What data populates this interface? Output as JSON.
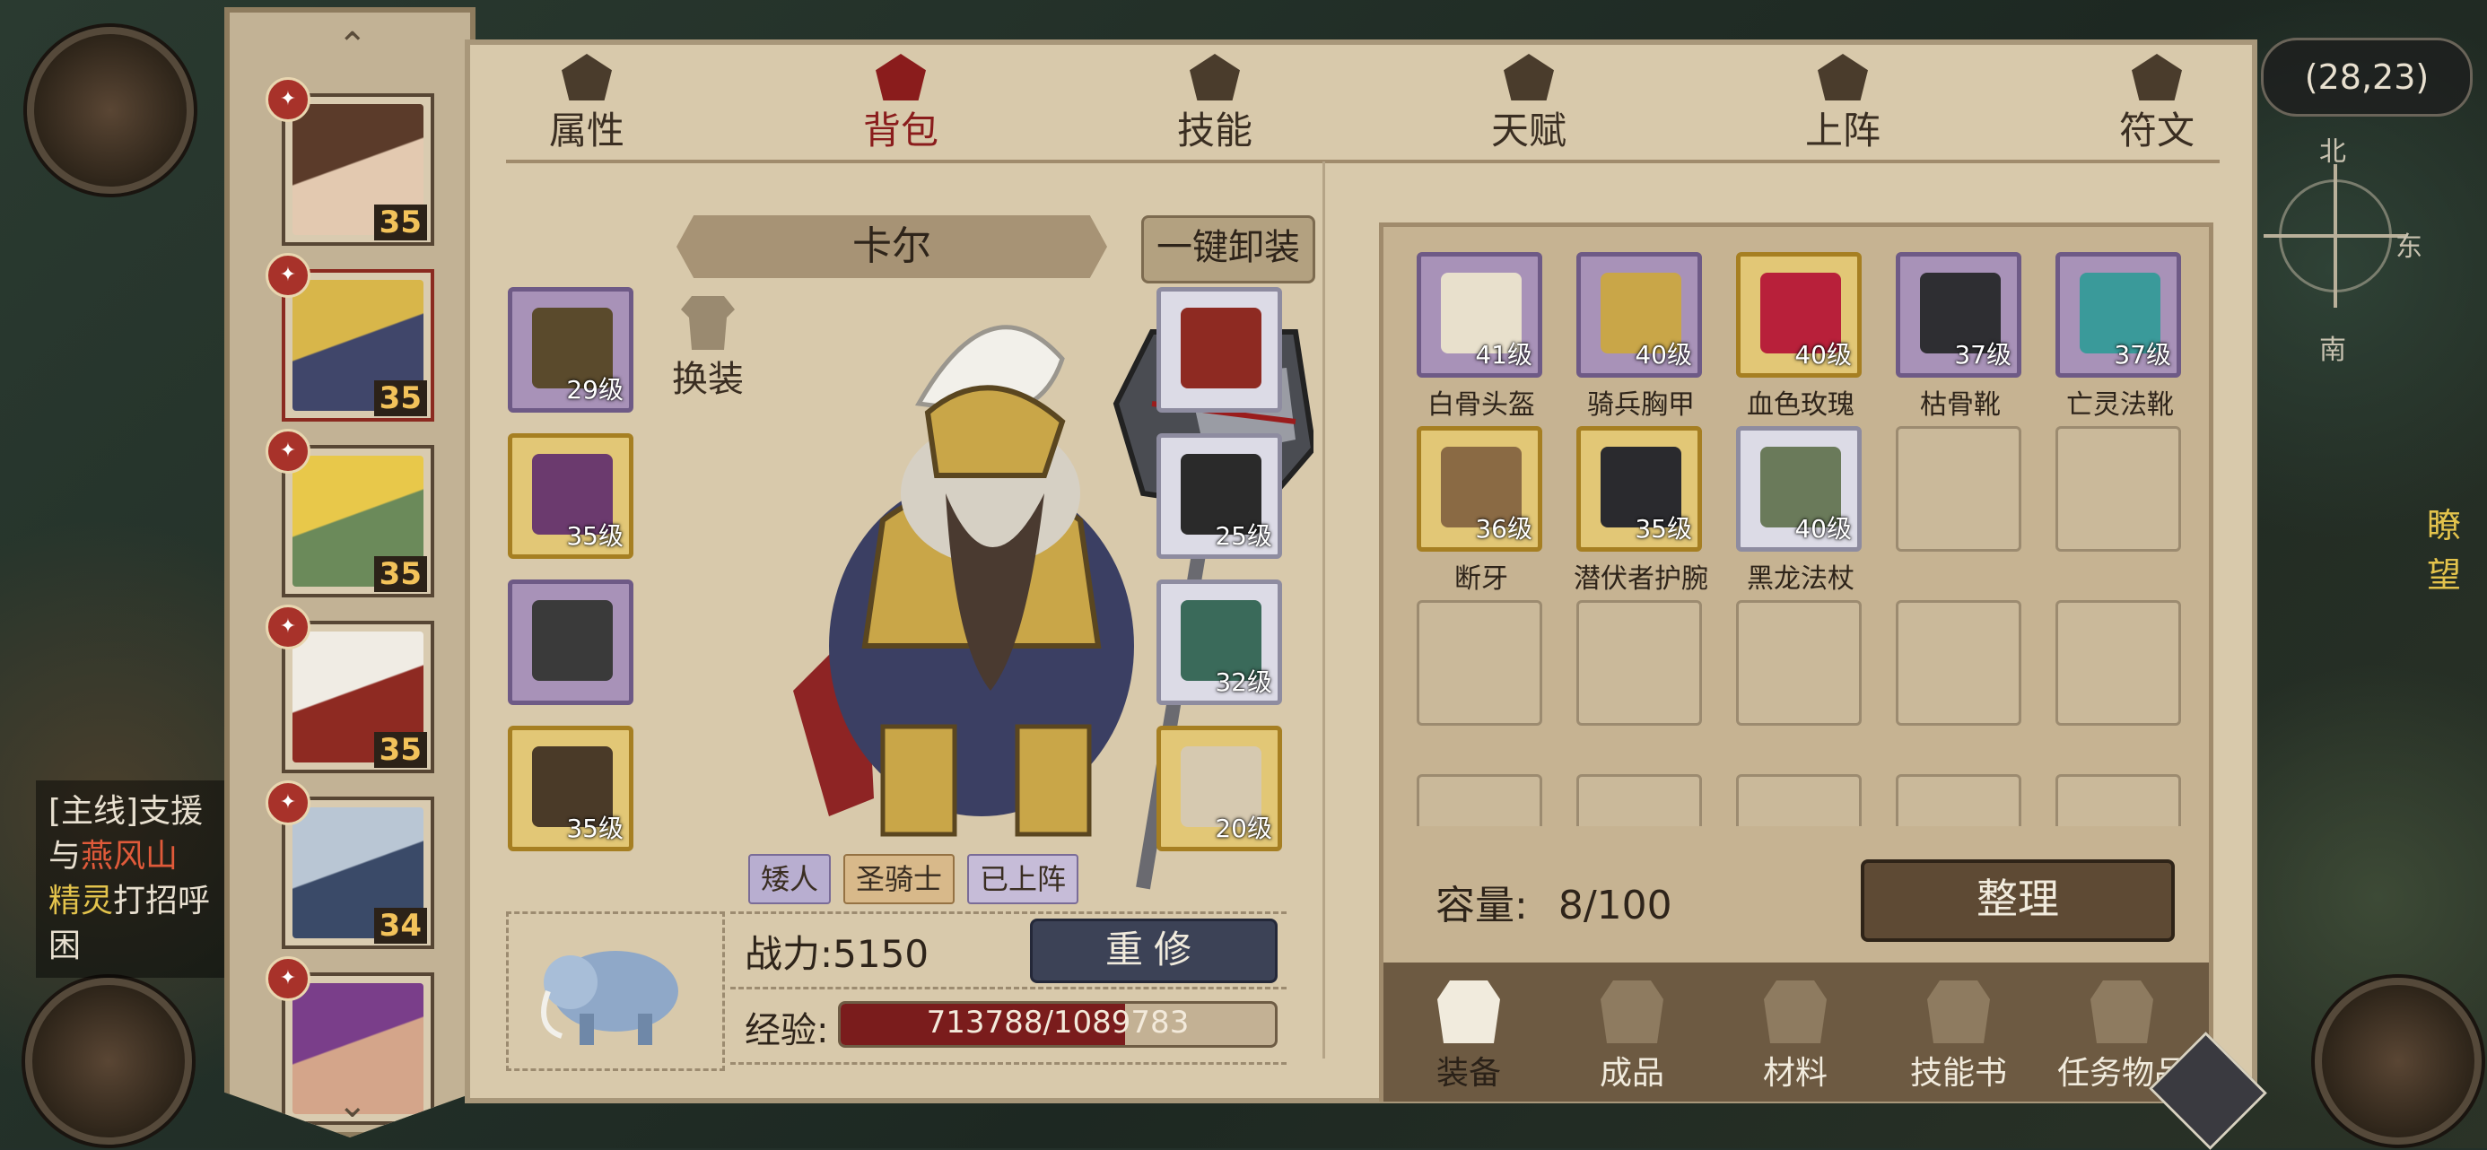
{
  "map": {
    "coord": "(28,23)",
    "compass": {
      "north": "北",
      "east": "东",
      "south": "南"
    },
    "side_text": "瞭望"
  },
  "quest": {
    "tag": "[主线]支援",
    "line1_a": "与",
    "line1_b": "燕风山",
    "line2_a": "精灵",
    "line2_b": "打招呼",
    "line3": "困"
  },
  "heroes": [
    {
      "level": "35",
      "colors": [
        "#5b3b2a",
        "#e3c9b0"
      ]
    },
    {
      "level": "35",
      "colors": [
        "#d8b64a",
        "#40466a"
      ],
      "selected": true
    },
    {
      "level": "35",
      "colors": [
        "#e8c84a",
        "#6b8a5a"
      ]
    },
    {
      "level": "35",
      "colors": [
        "#f0ece4",
        "#8e2a22"
      ]
    },
    {
      "level": "34",
      "colors": [
        "#b9c6d4",
        "#3a4a68"
      ]
    },
    {
      "level": "",
      "colors": [
        "#7a3e8a",
        "#d4a58a"
      ]
    }
  ],
  "tabs": [
    "属性",
    "背包",
    "技能",
    "天赋",
    "上阵",
    "符文"
  ],
  "active_tab": 1,
  "character": {
    "name": "卡尔",
    "unequip_all": "一键卸装",
    "swap": "换装",
    "tags": [
      "矮人",
      "圣骑士",
      "已上阵"
    ],
    "power": "战力:5150",
    "rebuild": "重修",
    "exp_label": "经验:",
    "exp_text": "713788/1089783",
    "exp_ratio": 0.655
  },
  "equip_left": [
    {
      "level": "29级",
      "quality": "purple",
      "art": "#5a4a2c"
    },
    {
      "level": "35级",
      "quality": "gold",
      "art": "#6b3a6e"
    },
    {
      "level": "",
      "quality": "purple",
      "art": "#3a3a3a"
    },
    {
      "level": "35级",
      "quality": "gold",
      "art": "#4a3a28"
    }
  ],
  "equip_right": [
    {
      "level": "",
      "quality": "white",
      "art": "#8e2a22"
    },
    {
      "level": "25级",
      "quality": "white",
      "art": "#2a2a2a"
    },
    {
      "level": "32级",
      "quality": "white",
      "art": "#3a6a5a"
    },
    {
      "level": "20级",
      "quality": "gold",
      "art": "#d6c9b0"
    }
  ],
  "bag": {
    "items": [
      {
        "name": "白骨头盔",
        "level": "41级",
        "quality": "purple",
        "art": "#e8e0cc"
      },
      {
        "name": "骑兵胸甲",
        "level": "40级",
        "quality": "purple",
        "art": "#c9a648"
      },
      {
        "name": "血色玫瑰",
        "level": "40级",
        "quality": "gold",
        "art": "#b8203a"
      },
      {
        "name": "枯骨靴",
        "level": "37级",
        "quality": "purple",
        "art": "#2e2e32"
      },
      {
        "name": "亡灵法靴",
        "level": "37级",
        "quality": "purple",
        "art": "#3a9a9a"
      },
      {
        "name": "断牙",
        "level": "36级",
        "quality": "gold",
        "art": "#8a6a44"
      },
      {
        "name": "潜伏者护腕",
        "level": "35级",
        "quality": "gold",
        "art": "#2a2a2e"
      },
      {
        "name": "黑龙法杖",
        "level": "40级",
        "quality": "white",
        "art": "#6a7a5a"
      }
    ],
    "capacity_label": "容量:",
    "capacity_value": "8/100",
    "sort": "整理",
    "categories": [
      "装备",
      "成品",
      "材料",
      "技能书",
      "任务物品"
    ],
    "active_category": 0
  }
}
